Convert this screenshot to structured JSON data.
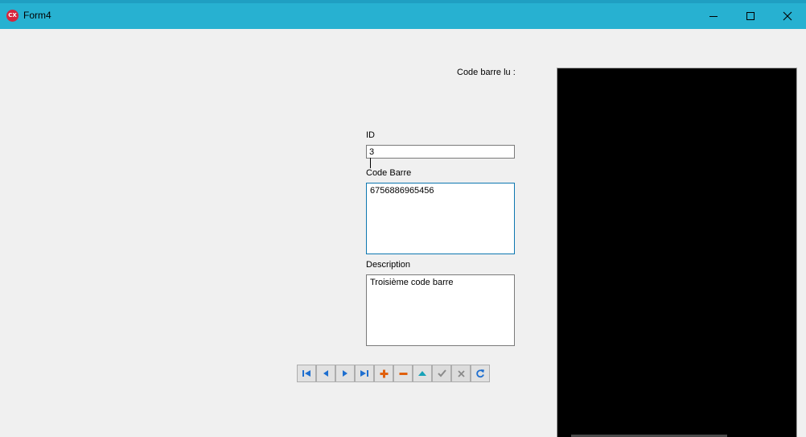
{
  "window": {
    "title": "Form4",
    "app_icon_text": "CX",
    "controls": [
      "minimize",
      "maximize",
      "close"
    ]
  },
  "form": {
    "scan_label": "Code barre lu :",
    "id_label": "ID",
    "id_value": "3",
    "code_label": "Code Barre",
    "code_value": "6756886965456",
    "desc_label": "Description",
    "desc_value": "Troisième code barre"
  },
  "navigator": {
    "buttons": [
      {
        "name": "first",
        "icon": "first-record-icon",
        "enabled": true
      },
      {
        "name": "prior",
        "icon": "prior-record-icon",
        "enabled": true
      },
      {
        "name": "next",
        "icon": "next-record-icon",
        "enabled": true
      },
      {
        "name": "last",
        "icon": "last-record-icon",
        "enabled": true
      },
      {
        "name": "insert",
        "icon": "plus-icon",
        "enabled": true
      },
      {
        "name": "delete",
        "icon": "minus-icon",
        "enabled": true
      },
      {
        "name": "edit",
        "icon": "edit-triangle-icon",
        "enabled": true
      },
      {
        "name": "post",
        "icon": "check-icon",
        "enabled": false
      },
      {
        "name": "cancel",
        "icon": "cancel-x-icon",
        "enabled": false
      },
      {
        "name": "refresh",
        "icon": "refresh-icon",
        "enabled": true
      }
    ]
  },
  "colors": {
    "titlebar": "#27b1d1",
    "nav_blue": "#1e6fd0",
    "nav_orange": "#e0600c",
    "nav_teal": "#17a2b8",
    "nav_disabled": "#8a8a8a",
    "camera_bg": "#000000"
  }
}
